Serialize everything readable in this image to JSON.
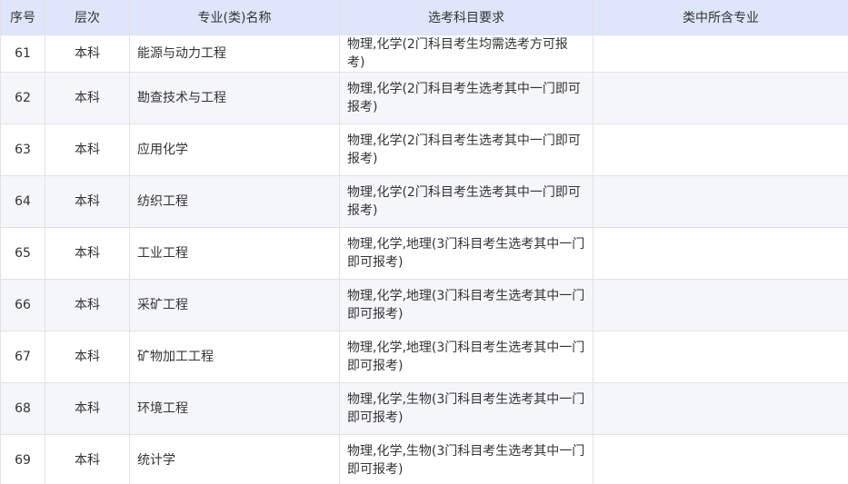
{
  "table": {
    "headers": [
      "序号",
      "层次",
      "专业(类)名称",
      "选考科目要求",
      "类中所含专业"
    ],
    "rows": [
      {
        "num": "61",
        "level": "本科",
        "major": "能源与动力工程",
        "requirement": "物理,化学(2门科目考生均需选考方可报考)",
        "included": ""
      },
      {
        "num": "62",
        "level": "本科",
        "major": "勘查技术与工程",
        "requirement": "物理,化学(2门科目考生选考其中一门即可报考)",
        "included": ""
      },
      {
        "num": "63",
        "level": "本科",
        "major": "应用化学",
        "requirement": "物理,化学(2门科目考生选考其中一门即可报考)",
        "included": ""
      },
      {
        "num": "64",
        "level": "本科",
        "major": "纺织工程",
        "requirement": "物理,化学(2门科目考生选考其中一门即可报考)",
        "included": ""
      },
      {
        "num": "65",
        "level": "本科",
        "major": "工业工程",
        "requirement": "物理,化学,地理(3门科目考生选考其中一门即可报考)",
        "included": ""
      },
      {
        "num": "66",
        "level": "本科",
        "major": "采矿工程",
        "requirement": "物理,化学,地理(3门科目考生选考其中一门即可报考)",
        "included": ""
      },
      {
        "num": "67",
        "level": "本科",
        "major": "矿物加工工程",
        "requirement": "物理,化学,地理(3门科目考生选考其中一门即可报考)",
        "included": ""
      },
      {
        "num": "68",
        "level": "本科",
        "major": "环境工程",
        "requirement": "物理,化学,生物(3门科目考生选考其中一门即可报考)",
        "included": ""
      },
      {
        "num": "69",
        "level": "本科",
        "major": "统计学",
        "requirement": "物理,化学,生物(3门科目考生选考其中一门即可报考)",
        "included": ""
      }
    ]
  }
}
